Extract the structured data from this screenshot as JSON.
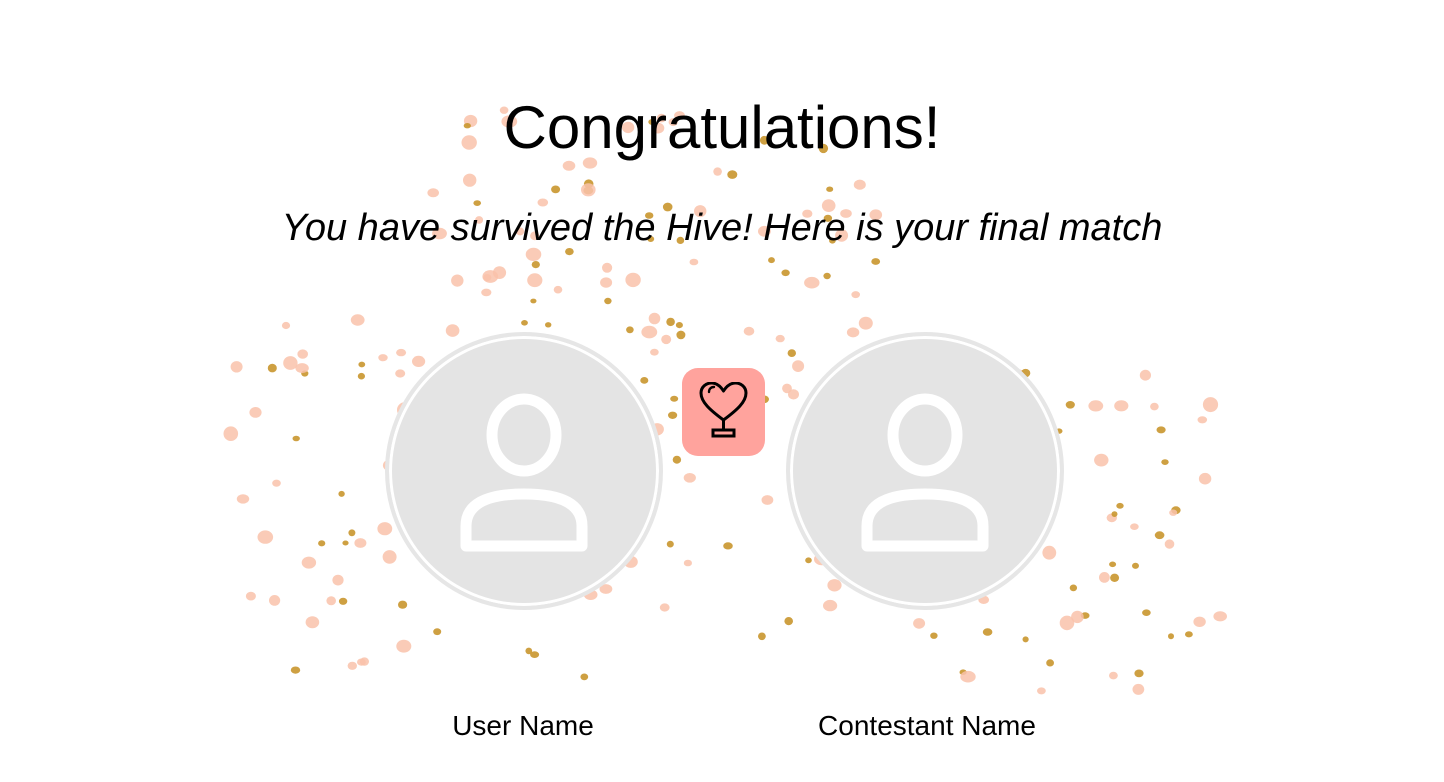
{
  "header": {
    "title": "Congratulations!",
    "subtitle": "You have survived the Hive! Here is your final match"
  },
  "match": {
    "user_name": "User Name",
    "contestant_name": "Contestant Name",
    "badge_icon": "heart-trophy-icon",
    "avatar_icon": "user-placeholder-icon"
  },
  "colors": {
    "badge_bg": "#ffa39d",
    "avatar_bg": "#e4e4e4",
    "confetti_pink": "#f9c2aa",
    "confetti_gold": "#c9962e"
  }
}
